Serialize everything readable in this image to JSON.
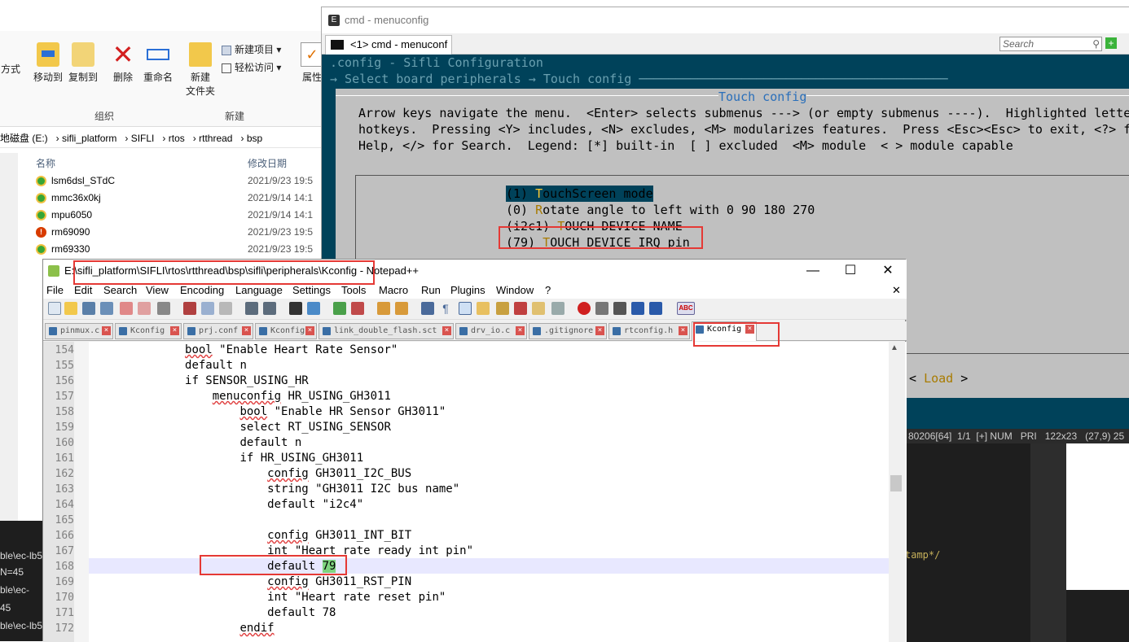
{
  "explorer": {
    "ribbon": {
      "partial_label": "方式",
      "move_to": "移动到",
      "copy_to": "复制到",
      "delete": "删除",
      "rename": "重命名",
      "new_folder_line1": "新建",
      "new_folder_line2": "文件夹",
      "new_item": "新建项目",
      "easy_access": "轻松访问",
      "properties": "属性",
      "group_organize": "组织",
      "group_new": "新建"
    },
    "address": [
      "地磁盘 (E:)",
      "sifli_platform",
      "SIFLI",
      "rtos",
      "rtthread",
      "bsp"
    ],
    "columns": {
      "name": "名称",
      "date": "修改日期"
    },
    "files": [
      {
        "name": "lsm6dsl_STdC",
        "date": "2021/9/23 19:5",
        "status": "ok"
      },
      {
        "name": "mmc36x0kj",
        "date": "2021/9/14 14:1",
        "status": "ok"
      },
      {
        "name": "mpu6050",
        "date": "2021/9/14 14:1",
        "status": "ok"
      },
      {
        "name": "rm69090",
        "date": "2021/9/23 19:5",
        "status": "err"
      },
      {
        "name": "rm69330",
        "date": "2021/9/23 19:5",
        "status": "ok"
      }
    ],
    "terminal_strip": [
      "ble\\ec-lb5",
      "N=45",
      "ble\\ec-",
      "45",
      "ble\\ec-lb5"
    ]
  },
  "cmd": {
    "title": "cmd - menuconfig",
    "tab": "<1> cmd - menuconf",
    "search_placeholder": "Search",
    "line1": ".config - Sifli Configuration",
    "line2": "→ Select board peripherals → Touch config ──────────────────────────────────────────",
    "dialog_title": "Touch config",
    "help1": "Arrow keys navigate the menu.  <Enter> selects submenus ---> (or empty submenus ----).  Highlighted letters are",
    "help2": "hotkeys.  Pressing <Y> includes, <N> excludes, <M> modularizes features.  Press <Esc><Esc> to exit, <?> for",
    "help3": "Help, </> for Search.  Legend: [*] built-in  [ ] excluded  <M> module  < > module capable",
    "items": [
      {
        "prefix": "(1) ",
        "hotkey": "T",
        "rest": "ouchScreen mode",
        "selected": true
      },
      {
        "prefix": "(0) ",
        "hotkey": "R",
        "rest": "otate angle to left with 0 90 180 270",
        "selected": false
      },
      {
        "prefix": "(i2c1) ",
        "hotkey": "T",
        "rest": "OUCH DEVICE NAME",
        "selected": false
      },
      {
        "prefix": "(79) ",
        "hotkey": "T",
        "rest": "OUCH DEVICE IRQ pin",
        "selected": false
      }
    ],
    "load_button": "Load",
    "load_left": "<",
    "load_right": ">",
    "status": "80206[64]  1/1  [+] NUM   PRI   122x23   (27,9) 25",
    "comment_fragment": "tamp*/"
  },
  "npp": {
    "title": "E:\\sifli_platform\\SIFLI\\rtos\\rtthread\\bsp\\sifli\\peripherals\\Kconfig - Notepad++",
    "menu": [
      "File",
      "Edit",
      "Search",
      "View",
      "Encoding",
      "Language",
      "Settings",
      "Tools",
      "Macro",
      "Run",
      "Plugins",
      "Window",
      "?"
    ],
    "tabs": [
      "pinmux.c",
      "Kconfig",
      "prj.conf",
      "Kconfig",
      "link_double_flash.sct",
      "drv_io.c",
      ".gitignore",
      "rtconfig.h",
      "Kconfig"
    ],
    "active_tab": 8,
    "lines": [
      {
        "n": "154",
        "indent": "    ",
        "kw": "bool",
        "text": " \"Enable Heart Rate Sensor\""
      },
      {
        "n": "155",
        "indent": "    ",
        "kw": "",
        "text": "default n"
      },
      {
        "n": "156",
        "indent": "    ",
        "kw": "",
        "text": "if SENSOR_USING_HR"
      },
      {
        "n": "157",
        "indent": "        ",
        "kw": "menuconfig",
        "text": " HR_USING_GH3011"
      },
      {
        "n": "158",
        "indent": "            ",
        "kw": "bool",
        "text": " \"Enable HR Sensor GH3011\""
      },
      {
        "n": "159",
        "indent": "            ",
        "kw": "",
        "text": "select RT_USING_SENSOR"
      },
      {
        "n": "160",
        "indent": "            ",
        "kw": "",
        "text": "default n"
      },
      {
        "n": "161",
        "indent": "            ",
        "kw": "",
        "text": "if HR_USING_GH3011"
      },
      {
        "n": "162",
        "indent": "                ",
        "kw": "config",
        "text": " GH3011_I2C_BUS"
      },
      {
        "n": "163",
        "indent": "                ",
        "kw": "",
        "text": "string \"GH3011 I2C bus name\""
      },
      {
        "n": "164",
        "indent": "                ",
        "kw": "",
        "text": "default \"i2c4\""
      },
      {
        "n": "165",
        "indent": "",
        "kw": "",
        "text": ""
      },
      {
        "n": "166",
        "indent": "                ",
        "kw": "config",
        "text": " GH3011_INT_BIT"
      },
      {
        "n": "167",
        "indent": "                ",
        "kw": "",
        "text": "int \"Heart rate ready int pin\""
      },
      {
        "n": "168",
        "indent": "                ",
        "kw": "",
        "text": "default ",
        "value": "79"
      },
      {
        "n": "169",
        "indent": "                ",
        "kw": "config",
        "text": " GH3011_RST_PIN"
      },
      {
        "n": "170",
        "indent": "                ",
        "kw": "",
        "text": "int \"Heart rate reset pin\""
      },
      {
        "n": "171",
        "indent": "                ",
        "kw": "",
        "text": "default 78"
      },
      {
        "n": "172",
        "indent": "            ",
        "kw": "endif",
        "text": ""
      }
    ]
  }
}
